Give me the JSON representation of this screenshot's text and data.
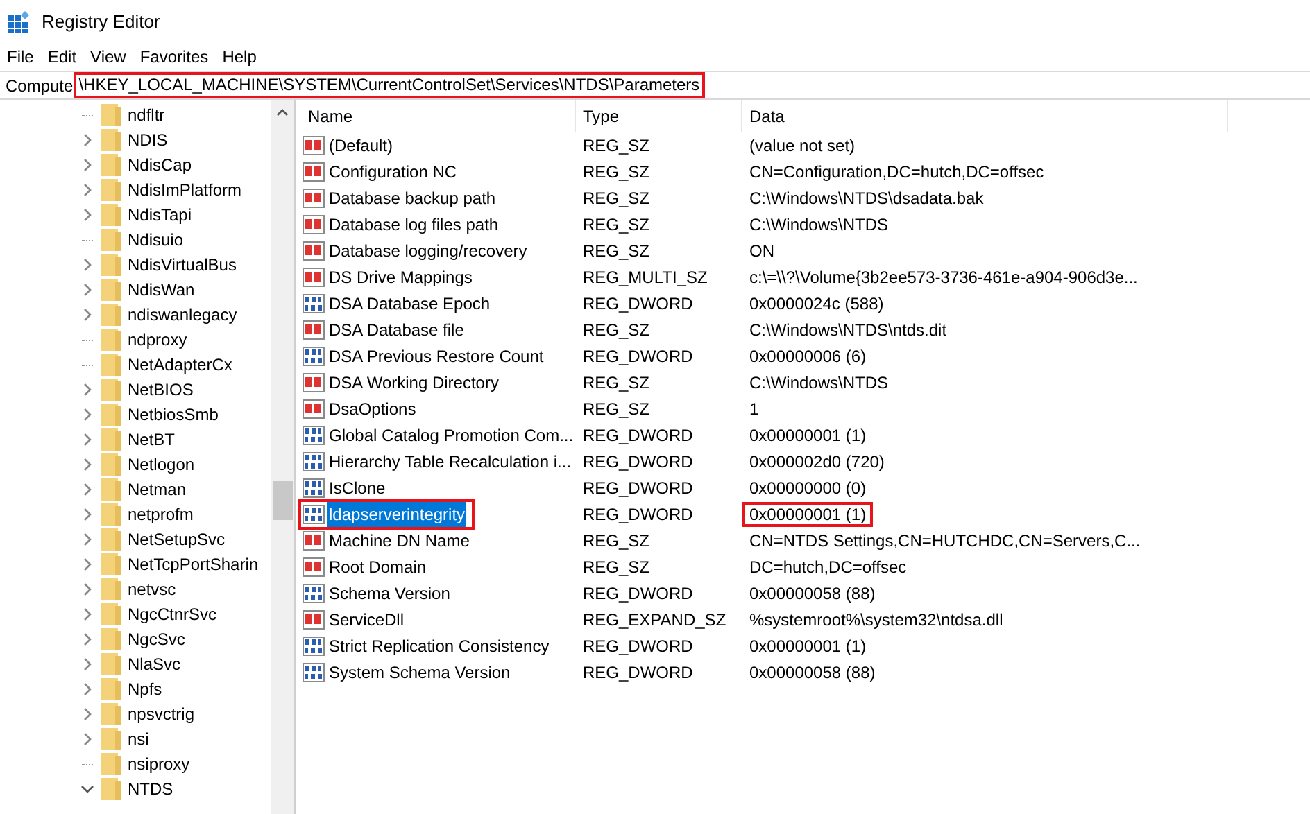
{
  "window": {
    "title": "Registry Editor"
  },
  "menu": [
    "File",
    "Edit",
    "View",
    "Favorites",
    "Help"
  ],
  "address": {
    "prefix": "Compute",
    "path": "\\HKEY_LOCAL_MACHINE\\SYSTEM\\CurrentControlSet\\Services\\NTDS\\Parameters",
    "highlighted": true
  },
  "tree": [
    {
      "name": "ndfltr",
      "has_children": false
    },
    {
      "name": "NDIS",
      "has_children": true,
      "expanded": false
    },
    {
      "name": "NdisCap",
      "has_children": true,
      "expanded": false
    },
    {
      "name": "NdisImPlatform",
      "has_children": true,
      "expanded": false
    },
    {
      "name": "NdisTapi",
      "has_children": true,
      "expanded": false
    },
    {
      "name": "Ndisuio",
      "has_children": false
    },
    {
      "name": "NdisVirtualBus",
      "has_children": true,
      "expanded": false
    },
    {
      "name": "NdisWan",
      "has_children": true,
      "expanded": false
    },
    {
      "name": "ndiswanlegacy",
      "has_children": true,
      "expanded": false
    },
    {
      "name": "ndproxy",
      "has_children": false
    },
    {
      "name": "NetAdapterCx",
      "has_children": false
    },
    {
      "name": "NetBIOS",
      "has_children": true,
      "expanded": false
    },
    {
      "name": "NetbiosSmb",
      "has_children": true,
      "expanded": false
    },
    {
      "name": "NetBT",
      "has_children": true,
      "expanded": false
    },
    {
      "name": "Netlogon",
      "has_children": true,
      "expanded": false
    },
    {
      "name": "Netman",
      "has_children": true,
      "expanded": false
    },
    {
      "name": "netprofm",
      "has_children": true,
      "expanded": false
    },
    {
      "name": "NetSetupSvc",
      "has_children": true,
      "expanded": false
    },
    {
      "name": "NetTcpPortSharin",
      "has_children": true,
      "expanded": false
    },
    {
      "name": "netvsc",
      "has_children": true,
      "expanded": false
    },
    {
      "name": "NgcCtnrSvc",
      "has_children": true,
      "expanded": false
    },
    {
      "name": "NgcSvc",
      "has_children": true,
      "expanded": false
    },
    {
      "name": "NlaSvc",
      "has_children": true,
      "expanded": false
    },
    {
      "name": "Npfs",
      "has_children": true,
      "expanded": false
    },
    {
      "name": "npsvctrig",
      "has_children": true,
      "expanded": false
    },
    {
      "name": "nsi",
      "has_children": true,
      "expanded": false
    },
    {
      "name": "nsiproxy",
      "has_children": false
    },
    {
      "name": "NTDS",
      "has_children": true,
      "expanded": true
    }
  ],
  "table": {
    "columns": [
      "Name",
      "Type",
      "Data"
    ],
    "rows": [
      {
        "name": "(Default)",
        "kind": "string",
        "type": "REG_SZ",
        "data": "(value not set)",
        "selected": false,
        "name_highlighted": false,
        "data_highlighted": false
      },
      {
        "name": "Configuration NC",
        "kind": "string",
        "type": "REG_SZ",
        "data": "CN=Configuration,DC=hutch,DC=offsec",
        "selected": false,
        "name_highlighted": false,
        "data_highlighted": false
      },
      {
        "name": "Database backup path",
        "kind": "string",
        "type": "REG_SZ",
        "data": "C:\\Windows\\NTDS\\dsadata.bak",
        "selected": false,
        "name_highlighted": false,
        "data_highlighted": false
      },
      {
        "name": "Database log files path",
        "kind": "string",
        "type": "REG_SZ",
        "data": "C:\\Windows\\NTDS",
        "selected": false,
        "name_highlighted": false,
        "data_highlighted": false
      },
      {
        "name": "Database logging/recovery",
        "kind": "string",
        "type": "REG_SZ",
        "data": "ON",
        "selected": false,
        "name_highlighted": false,
        "data_highlighted": false
      },
      {
        "name": "DS Drive Mappings",
        "kind": "string",
        "type": "REG_MULTI_SZ",
        "data": "c:\\=\\\\?\\Volume{3b2ee573-3736-461e-a904-906d3e...",
        "selected": false,
        "name_highlighted": false,
        "data_highlighted": false
      },
      {
        "name": "DSA Database Epoch",
        "kind": "binary",
        "type": "REG_DWORD",
        "data": "0x0000024c (588)",
        "selected": false,
        "name_highlighted": false,
        "data_highlighted": false
      },
      {
        "name": "DSA Database file",
        "kind": "string",
        "type": "REG_SZ",
        "data": "C:\\Windows\\NTDS\\ntds.dit",
        "selected": false,
        "name_highlighted": false,
        "data_highlighted": false
      },
      {
        "name": "DSA Previous Restore Count",
        "kind": "binary",
        "type": "REG_DWORD",
        "data": "0x00000006 (6)",
        "selected": false,
        "name_highlighted": false,
        "data_highlighted": false
      },
      {
        "name": "DSA Working Directory",
        "kind": "string",
        "type": "REG_SZ",
        "data": "C:\\Windows\\NTDS",
        "selected": false,
        "name_highlighted": false,
        "data_highlighted": false
      },
      {
        "name": "DsaOptions",
        "kind": "string",
        "type": "REG_SZ",
        "data": "1",
        "selected": false,
        "name_highlighted": false,
        "data_highlighted": false
      },
      {
        "name": "Global Catalog Promotion Com...",
        "kind": "binary",
        "type": "REG_DWORD",
        "data": "0x00000001 (1)",
        "selected": false,
        "name_highlighted": false,
        "data_highlighted": false
      },
      {
        "name": "Hierarchy Table Recalculation i...",
        "kind": "binary",
        "type": "REG_DWORD",
        "data": "0x000002d0 (720)",
        "selected": false,
        "name_highlighted": false,
        "data_highlighted": false
      },
      {
        "name": "IsClone",
        "kind": "binary",
        "type": "REG_DWORD",
        "data": "0x00000000 (0)",
        "selected": false,
        "name_highlighted": false,
        "data_highlighted": false
      },
      {
        "name": "ldapserverintegrity",
        "kind": "binary",
        "type": "REG_DWORD",
        "data": "0x00000001 (1)",
        "selected": true,
        "name_highlighted": true,
        "data_highlighted": true
      },
      {
        "name": "Machine DN Name",
        "kind": "string",
        "type": "REG_SZ",
        "data": "CN=NTDS Settings,CN=HUTCHDC,CN=Servers,C...",
        "selected": false,
        "name_highlighted": false,
        "data_highlighted": false
      },
      {
        "name": "Root Domain",
        "kind": "string",
        "type": "REG_SZ",
        "data": "DC=hutch,DC=offsec",
        "selected": false,
        "name_highlighted": false,
        "data_highlighted": false
      },
      {
        "name": "Schema Version",
        "kind": "binary",
        "type": "REG_DWORD",
        "data": "0x00000058 (88)",
        "selected": false,
        "name_highlighted": false,
        "data_highlighted": false
      },
      {
        "name": "ServiceDll",
        "kind": "string",
        "type": "REG_EXPAND_SZ",
        "data": "%systemroot%\\system32\\ntdsa.dll",
        "selected": false,
        "name_highlighted": false,
        "data_highlighted": false
      },
      {
        "name": "Strict Replication Consistency",
        "kind": "binary",
        "type": "REG_DWORD",
        "data": "0x00000001 (1)",
        "selected": false,
        "name_highlighted": false,
        "data_highlighted": false
      },
      {
        "name": "System Schema Version",
        "kind": "binary",
        "type": "REG_DWORD",
        "data": "0x00000058 (88)",
        "selected": false,
        "name_highlighted": false,
        "data_highlighted": false
      }
    ]
  }
}
